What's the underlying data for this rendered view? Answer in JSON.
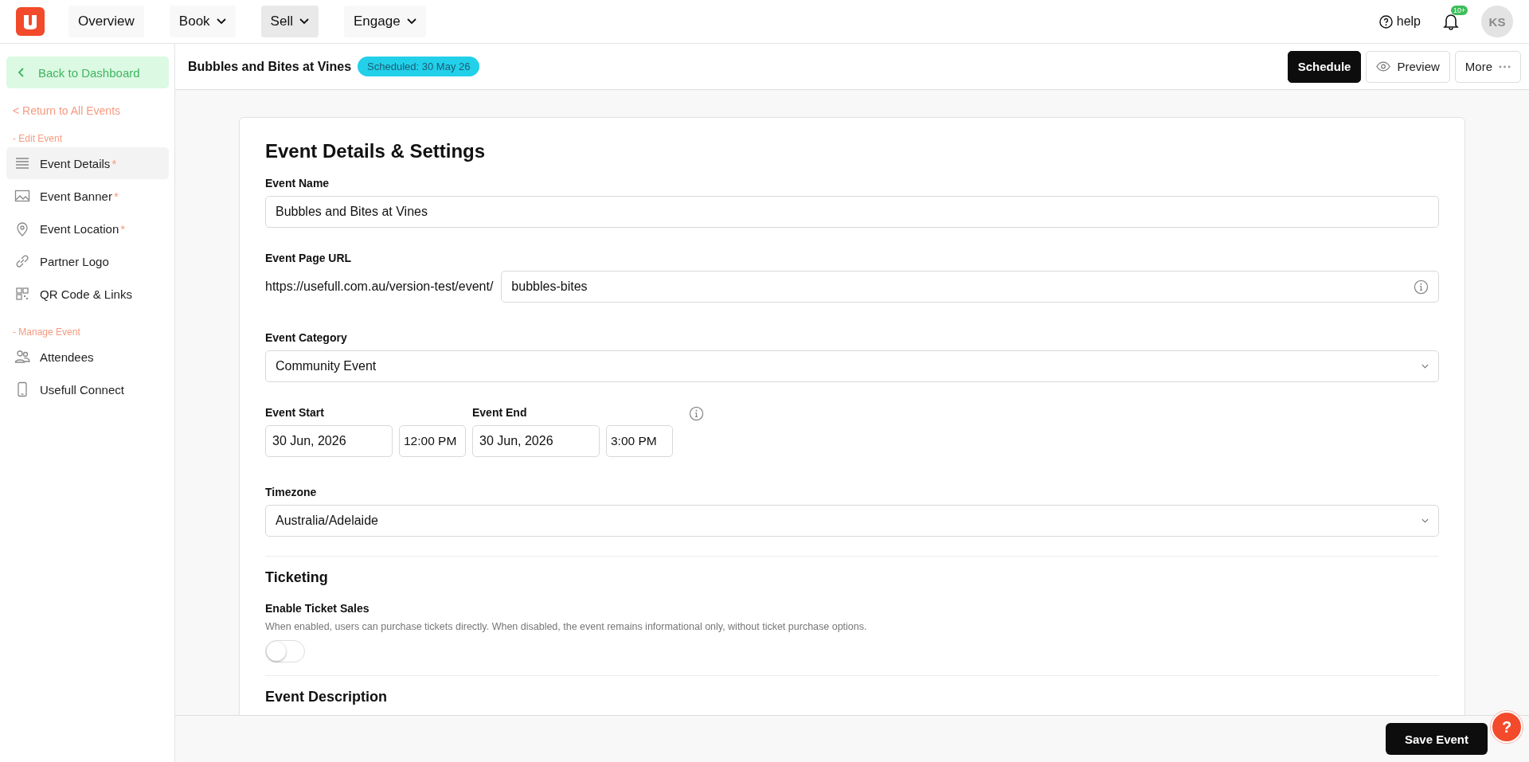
{
  "top_nav": {
    "items": [
      {
        "label": "Overview",
        "dropdown": false,
        "selected": false
      },
      {
        "label": "Book",
        "dropdown": true,
        "selected": false
      },
      {
        "label": "Sell",
        "dropdown": true,
        "selected": true
      },
      {
        "label": "Engage",
        "dropdown": true,
        "selected": false
      }
    ],
    "help": "help",
    "notification_badge": "10+",
    "avatar": "KS"
  },
  "sidebar": {
    "back_button": "Back to Dashboard",
    "return_link": "< Return to All Events",
    "sections": [
      {
        "label": "- Edit Event",
        "items": [
          {
            "label": "Event Details",
            "marker": "*",
            "selected": true
          },
          {
            "label": "Event Banner",
            "marker": "*",
            "selected": false
          },
          {
            "label": "Event Location",
            "marker": "*",
            "selected": false
          },
          {
            "label": "Partner Logo",
            "selected": false
          },
          {
            "label": "QR Code & Links",
            "selected": false
          }
        ]
      },
      {
        "label": "- Manage Event",
        "items": [
          {
            "label": "Attendees",
            "selected": false
          },
          {
            "label": "Usefull Connect",
            "selected": false
          }
        ]
      }
    ]
  },
  "header": {
    "title": "Bubbles and Bites at Vines",
    "status_badge": "Scheduled: 30 May 26",
    "buttons": [
      "Schedule",
      "Preview",
      "More"
    ]
  },
  "form": {
    "title": "Event Details & Settings",
    "event_name": {
      "label": "Event Name",
      "value": "Bubbles and Bites at Vines"
    },
    "event_url": {
      "label": "Event Page URL",
      "prefix": "https://usefull.com.au/version-test/event/",
      "value": "bubbles-bites"
    },
    "category": {
      "label": "Event Category",
      "value": "Community Event"
    },
    "start": {
      "label": "Event Start",
      "date": "30 Jun, 2026",
      "time": "12:00 PM"
    },
    "end": {
      "label": "Event End",
      "date": "30 Jun, 2026",
      "time": "3:00 PM"
    },
    "timezone": {
      "label": "Timezone",
      "value": "Australia/Adelaide"
    },
    "ticketing": {
      "title": "Ticketing",
      "label": "Enable Ticket Sales",
      "description": "When enabled, users can purchase tickets directly. When disabled, the event remains informational only, without ticket purchase options.",
      "enabled": false
    },
    "description_title": "Event Description"
  },
  "footer": {
    "save_button": "Save Event",
    "help_bubble": "?"
  }
}
